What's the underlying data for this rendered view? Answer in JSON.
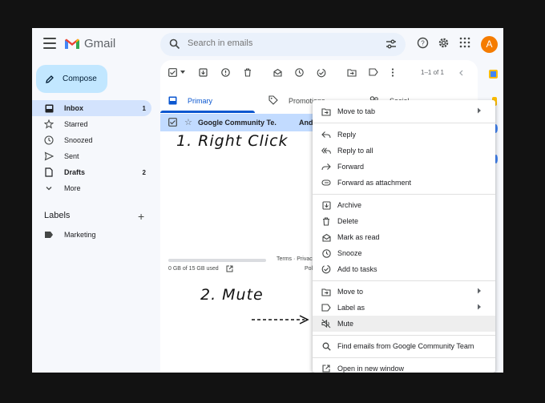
{
  "header": {
    "app_name": "Gmail",
    "search_placeholder": "Search in emails",
    "avatar_initial": "A"
  },
  "sidebar": {
    "compose_label": "Compose",
    "items": [
      {
        "label": "Inbox",
        "count": "1",
        "icon": "inbox-icon"
      },
      {
        "label": "Starred",
        "count": "",
        "icon": "star-icon"
      },
      {
        "label": "Snoozed",
        "count": "",
        "icon": "clock-icon"
      },
      {
        "label": "Sent",
        "count": "",
        "icon": "send-icon"
      },
      {
        "label": "Drafts",
        "count": "2",
        "icon": "draft-icon"
      },
      {
        "label": "More",
        "count": "",
        "icon": "chevron-down-icon"
      }
    ],
    "labels_title": "Labels",
    "labels_add": "+",
    "labels": [
      {
        "label": "Marketing",
        "icon": "label-icon"
      }
    ]
  },
  "toolbar": {
    "pager": "1–1 of 1"
  },
  "tabs": [
    {
      "label": "Primary",
      "icon": "inbox-icon",
      "active": true
    },
    {
      "label": "Promotions",
      "icon": "tag-icon",
      "active": false
    },
    {
      "label": "Social",
      "icon": "people-icon",
      "active": false
    }
  ],
  "email": {
    "sender": "Google Community Te.",
    "subject_fragment": "And"
  },
  "footer": {
    "storage": "0 GB of 15 GB used",
    "terms": "Terms · Privac",
    "policy_fragment": "Poli"
  },
  "annotations": {
    "step1": "1. Right Click",
    "step2": "2. Mute"
  },
  "context_menu": {
    "items": [
      {
        "label": "Move to tab",
        "icon": "move-to-tab-icon",
        "submenu": true
      },
      {
        "label": "Reply",
        "icon": "reply-icon",
        "submenu": false
      },
      {
        "label": "Reply to all",
        "icon": "reply-all-icon",
        "submenu": false
      },
      {
        "label": "Forward",
        "icon": "forward-icon",
        "submenu": false
      },
      {
        "label": "Forward as attachment",
        "icon": "attachment-icon",
        "submenu": false
      },
      {
        "label": "Archive",
        "icon": "archive-icon",
        "submenu": false
      },
      {
        "label": "Delete",
        "icon": "trash-icon",
        "submenu": false
      },
      {
        "label": "Mark as read",
        "icon": "mail-open-icon",
        "submenu": false
      },
      {
        "label": "Snooze",
        "icon": "clock-icon",
        "submenu": false
      },
      {
        "label": "Add to tasks",
        "icon": "add-task-icon",
        "submenu": false
      },
      {
        "label": "Move to",
        "icon": "move-to-icon",
        "submenu": true
      },
      {
        "label": "Label as",
        "icon": "label-icon",
        "submenu": true
      },
      {
        "label": "Mute",
        "icon": "mute-icon",
        "submenu": false,
        "highlighted": true
      },
      {
        "label": "Find emails from Google Community Team",
        "icon": "search-icon",
        "submenu": false
      },
      {
        "label": "Open in new window",
        "icon": "open-new-window-icon",
        "submenu": false
      }
    ]
  },
  "colors": {
    "accent": "#0b57d0",
    "compose_bg": "#c2e7ff",
    "selected_row": "#c2dbff",
    "avatar": "#f57c00"
  }
}
